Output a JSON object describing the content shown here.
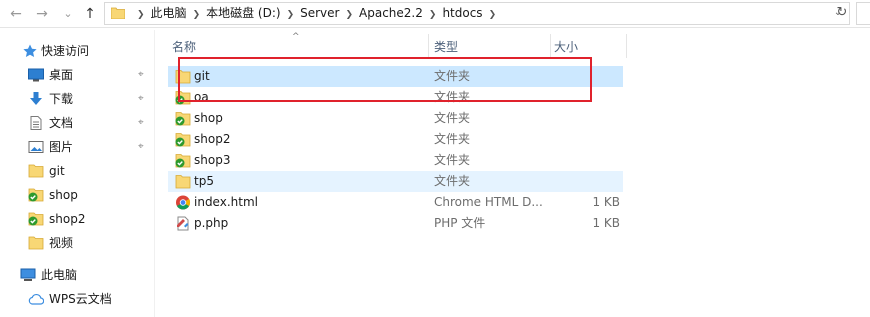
{
  "nav": {
    "back": "←",
    "forward": "→",
    "recent": "⌄",
    "up": "↑",
    "refresh": "↻",
    "address_dropdown": "⌄"
  },
  "breadcrumb": [
    "此电脑",
    "本地磁盘 (D:)",
    "Server",
    "Apache2.2",
    "htdocs"
  ],
  "sidebar": {
    "items": [
      {
        "label": "快速访问",
        "icon": "star-icon",
        "pinned": false
      },
      {
        "label": "桌面",
        "icon": "desktop-icon",
        "pinned": true
      },
      {
        "label": "下载",
        "icon": "download-icon",
        "pinned": true
      },
      {
        "label": "文档",
        "icon": "document-icon",
        "pinned": true
      },
      {
        "label": "图片",
        "icon": "picture-icon",
        "pinned": true
      },
      {
        "label": "git",
        "icon": "folder-icon",
        "pinned": false
      },
      {
        "label": "shop",
        "icon": "folder-sync-icon",
        "pinned": false
      },
      {
        "label": "shop2",
        "icon": "folder-sync-icon",
        "pinned": false
      },
      {
        "label": "视频",
        "icon": "folder-icon",
        "pinned": false
      },
      {
        "label": "此电脑",
        "icon": "computer-icon",
        "pinned": false
      },
      {
        "label": "WPS云文档",
        "icon": "cloud-icon",
        "pinned": false
      }
    ],
    "pin_glyph": "📌"
  },
  "columns": {
    "name": "名称",
    "type": "类型",
    "size": "大小",
    "sort_caret": "^"
  },
  "files": [
    {
      "name": "git",
      "type": "文件夹",
      "size": "",
      "icon": "folder-icon",
      "state": "selected"
    },
    {
      "name": "oa",
      "type": "文件夹",
      "size": "",
      "icon": "folder-sync-icon",
      "state": ""
    },
    {
      "name": "shop",
      "type": "文件夹",
      "size": "",
      "icon": "folder-sync-icon",
      "state": ""
    },
    {
      "name": "shop2",
      "type": "文件夹",
      "size": "",
      "icon": "folder-sync-icon",
      "state": ""
    },
    {
      "name": "shop3",
      "type": "文件夹",
      "size": "",
      "icon": "folder-sync-icon",
      "state": ""
    },
    {
      "name": "tp5",
      "type": "文件夹",
      "size": "",
      "icon": "folder-icon",
      "state": "hover"
    },
    {
      "name": "index.html",
      "type": "Chrome HTML D...",
      "size": "1 KB",
      "icon": "chrome-icon",
      "state": ""
    },
    {
      "name": "p.php",
      "type": "PHP 文件",
      "size": "1 KB",
      "icon": "php-file-icon",
      "state": ""
    }
  ],
  "colors": {
    "selected": "#cce8ff",
    "hover": "#e5f3ff",
    "highlight_box": "#e0222c",
    "folder": "#f8d775",
    "sync_check": "#2e9a2e"
  }
}
